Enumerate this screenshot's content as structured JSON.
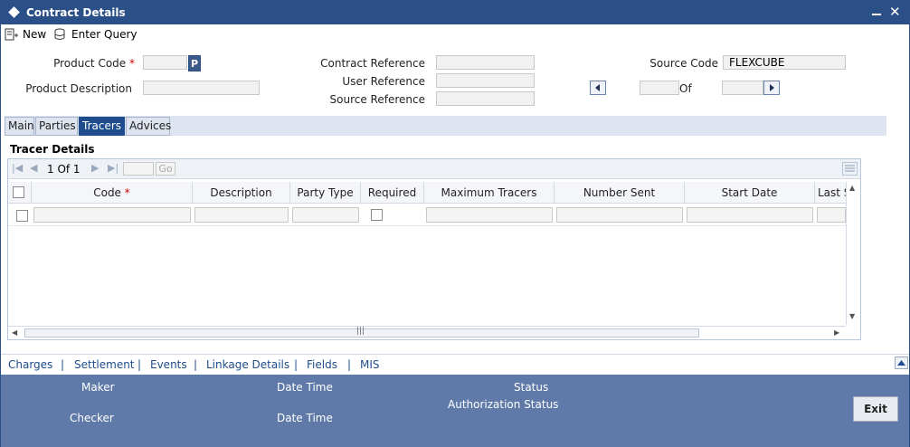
{
  "window": {
    "title": "Contract Details"
  },
  "toolbar": {
    "new_label": "New",
    "enter_query_label": "Enter Query"
  },
  "form": {
    "product_code_label": "Product Code",
    "product_code_value": "",
    "p_button": "P",
    "product_description_label": "Product Description",
    "contract_reference_label": "Contract Reference",
    "user_reference_label": "User Reference",
    "source_reference_label": "Source Reference",
    "source_code_label": "Source Code",
    "source_code_value": "FLEXCUBE",
    "of_label": "Of"
  },
  "tabs": [
    {
      "label": "Main"
    },
    {
      "label": "Parties"
    },
    {
      "label": "Tracers",
      "active": true
    },
    {
      "label": "Advices"
    }
  ],
  "tracer": {
    "section_title": "Tracer Details",
    "page_info": "1 Of 1",
    "go_label": "Go",
    "columns": [
      "Code",
      "Description",
      "Party Type",
      "Required",
      "Maximum Tracers",
      "Number Sent",
      "Start Date",
      "Last S"
    ]
  },
  "links": [
    "Charges",
    "Settlement",
    "Events",
    "Linkage Details",
    "Fields",
    "MIS"
  ],
  "footer": {
    "maker_label": "Maker",
    "checker_label": "Checker",
    "date_time_label": "Date Time",
    "date_time_label_2": "Date Time",
    "status_label": "Status",
    "authorization_status_label": "Authorization Status",
    "exit_label": "Exit"
  },
  "colors": {
    "title_bar": "#2b4f87",
    "active_tab": "#1e4c8c",
    "footer": "#5f7aa8",
    "required_star": "#cc0000"
  }
}
